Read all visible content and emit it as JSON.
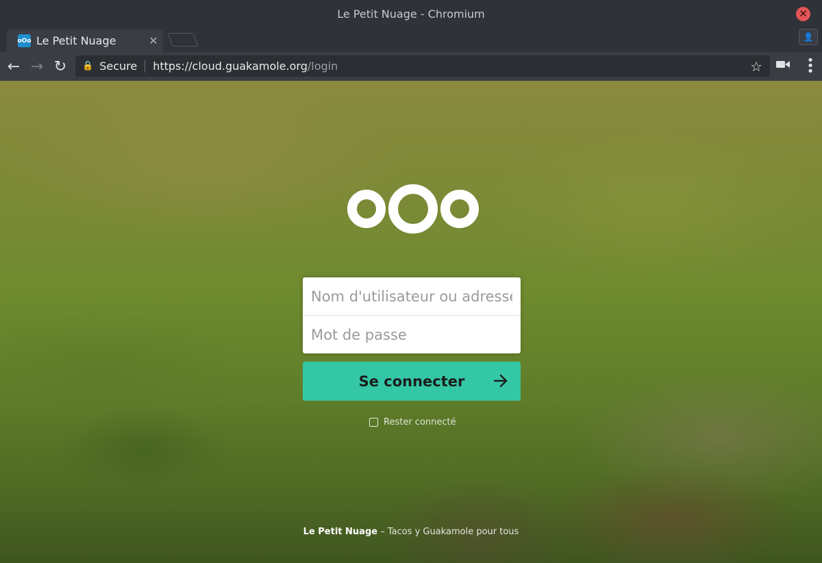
{
  "window": {
    "title": "Le Petit Nuage - Chromium"
  },
  "tab": {
    "title": "Le Petit Nuage",
    "favicon_text": "oOo"
  },
  "omnibox": {
    "secure_label": "Secure",
    "url_main": "https://cloud.guakamole.org",
    "url_path": "/login"
  },
  "login": {
    "username_placeholder": "Nom d'utilisateur ou adresse e-mail",
    "password_placeholder": "Mot de passe",
    "submit_label": "Se connecter",
    "remember_label": "Rester connecté"
  },
  "footer": {
    "brand": "Le Petit Nuage",
    "separator": " – ",
    "tagline": "Tacos y Guakamole pour tous"
  },
  "colors": {
    "accent": "#34c7a6",
    "window_close": "#e45454",
    "favicon": "#1d8fce"
  },
  "icons": [
    "lock-icon",
    "star-icon",
    "back-arrow-icon",
    "forward-arrow-icon",
    "reload-icon",
    "cast-icon",
    "menu-icon",
    "arrow-right-icon",
    "profile-icon",
    "close-icon"
  ]
}
